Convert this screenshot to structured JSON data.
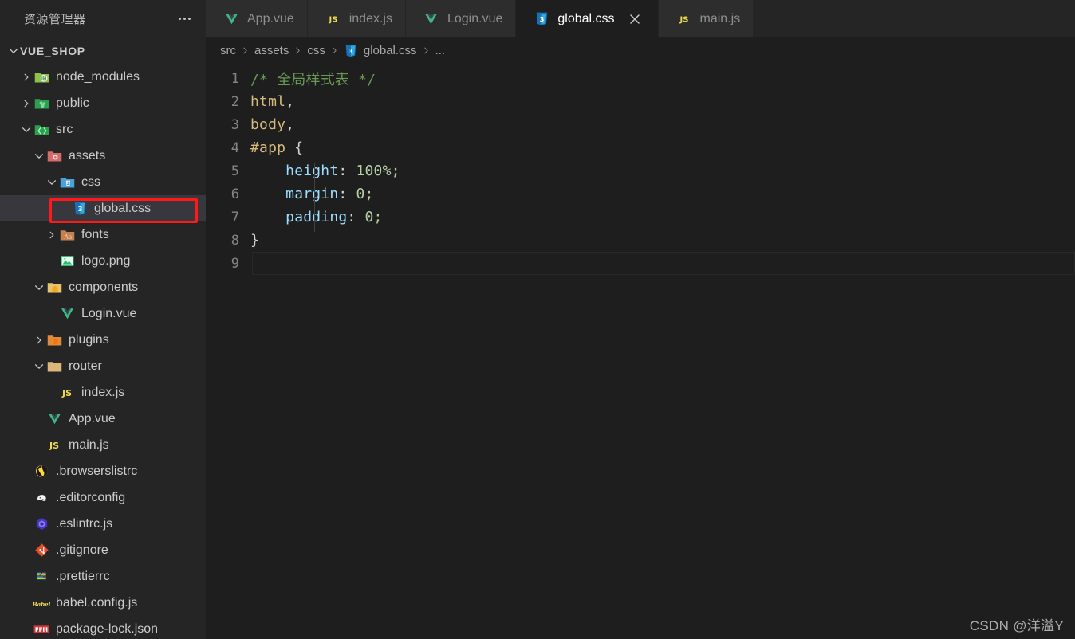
{
  "sidebar": {
    "title": "资源管理器",
    "more_actions_label": "...",
    "root": {
      "label": "VUE_SHOP",
      "expanded": true
    },
    "items": [
      {
        "label": "node_modules",
        "icon": "folder-node-modules-icon",
        "kind": "folder",
        "state": "collapsed",
        "indent": 1
      },
      {
        "label": "public",
        "icon": "folder-public-icon",
        "kind": "folder",
        "state": "collapsed",
        "indent": 1
      },
      {
        "label": "src",
        "icon": "folder-src-icon",
        "kind": "folder",
        "state": "expanded",
        "indent": 1
      },
      {
        "label": "assets",
        "icon": "folder-assets-icon",
        "kind": "folder",
        "state": "expanded",
        "indent": 2
      },
      {
        "label": "css",
        "icon": "folder-css-icon",
        "kind": "folder",
        "state": "expanded",
        "indent": 3
      },
      {
        "label": "global.css",
        "icon": "css-file-icon",
        "kind": "file",
        "state": "none",
        "indent": 4,
        "selected": true,
        "highlighted": true
      },
      {
        "label": "fonts",
        "icon": "folder-fonts-icon",
        "kind": "folder",
        "state": "collapsed",
        "indent": 3
      },
      {
        "label": "logo.png",
        "icon": "image-file-icon",
        "kind": "file",
        "state": "none",
        "indent": 3
      },
      {
        "label": "components",
        "icon": "folder-components-icon",
        "kind": "folder",
        "state": "expanded",
        "indent": 2
      },
      {
        "label": "Login.vue",
        "icon": "vue-file-icon",
        "kind": "file",
        "state": "none",
        "indent": 3
      },
      {
        "label": "plugins",
        "icon": "folder-plugins-icon",
        "kind": "folder",
        "state": "collapsed",
        "indent": 2
      },
      {
        "label": "router",
        "icon": "folder-router-icon",
        "kind": "folder",
        "state": "expanded",
        "indent": 2
      },
      {
        "label": "index.js",
        "icon": "js-file-icon",
        "kind": "file",
        "state": "none",
        "indent": 3
      },
      {
        "label": "App.vue",
        "icon": "vue-file-icon",
        "kind": "file",
        "state": "none",
        "indent": 2
      },
      {
        "label": "main.js",
        "icon": "js-file-icon",
        "kind": "file",
        "state": "none",
        "indent": 2
      },
      {
        "label": ".browserslistrc",
        "icon": "browserslist-file-icon",
        "kind": "file",
        "state": "none",
        "indent": 1
      },
      {
        "label": ".editorconfig",
        "icon": "editorconfig-file-icon",
        "kind": "file",
        "state": "none",
        "indent": 1
      },
      {
        "label": ".eslintrc.js",
        "icon": "eslint-file-icon",
        "kind": "file",
        "state": "none",
        "indent": 1
      },
      {
        "label": ".gitignore",
        "icon": "git-file-icon",
        "kind": "file",
        "state": "none",
        "indent": 1
      },
      {
        "label": ".prettierrc",
        "icon": "prettier-file-icon",
        "kind": "file",
        "state": "none",
        "indent": 1
      },
      {
        "label": "babel.config.js",
        "icon": "babel-file-icon",
        "kind": "file",
        "state": "none",
        "indent": 1
      },
      {
        "label": "package-lock.json",
        "icon": "npm-file-icon",
        "kind": "file",
        "state": "none",
        "indent": 1
      }
    ]
  },
  "tabs": [
    {
      "label": "App.vue",
      "icon": "vue-file-icon",
      "active": false,
      "closable": false
    },
    {
      "label": "index.js",
      "icon": "js-file-icon",
      "active": false,
      "closable": false
    },
    {
      "label": "Login.vue",
      "icon": "vue-file-icon",
      "active": false,
      "closable": false
    },
    {
      "label": "global.css",
      "icon": "css-file-icon",
      "active": true,
      "closable": true
    },
    {
      "label": "main.js",
      "icon": "js-file-icon",
      "active": false,
      "closable": false
    }
  ],
  "breadcrumb": {
    "items": [
      "src",
      "assets",
      "css"
    ],
    "file": "global.css",
    "file_icon": "css-file-icon",
    "overflow": "..."
  },
  "editor": {
    "lines": [
      {
        "number": "1",
        "text": "/* 全局样式表 */"
      },
      {
        "number": "2",
        "text": "html,"
      },
      {
        "number": "3",
        "text": "body,"
      },
      {
        "number": "4",
        "text": "#app {"
      },
      {
        "number": "5",
        "text": "    height: 100%;"
      },
      {
        "number": "6",
        "text": "    margin: 0;"
      },
      {
        "number": "7",
        "text": "    padding: 0;"
      },
      {
        "number": "8",
        "text": "}"
      },
      {
        "number": "9",
        "text": ""
      }
    ],
    "cursor_line": 9
  },
  "watermark": "CSDN @洋溢Y",
  "colors": {
    "sidebar_bg": "#252526",
    "editor_bg": "#1e1e1e",
    "tab_inactive_bg": "#2d2d2d",
    "selected_row_bg": "#37373d",
    "annotation_red": "#ff1a1a",
    "comment_green": "#6a9955",
    "selector_gold": "#d7ba7d",
    "property_blue": "#9cdcfe",
    "value_green": "#b5cea8",
    "line_number": "#858585"
  }
}
